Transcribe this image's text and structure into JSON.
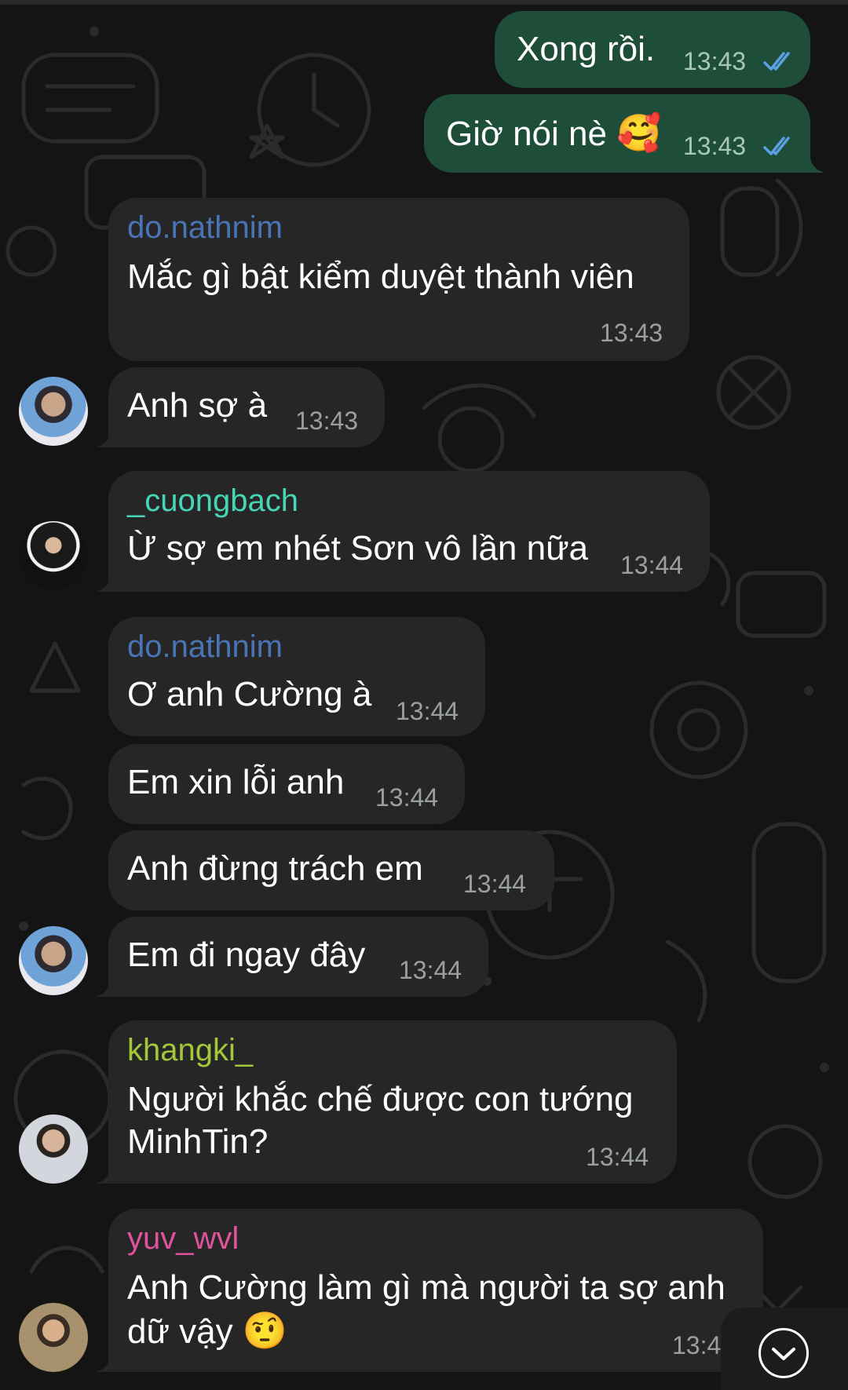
{
  "colors": {
    "background": "#141414",
    "incoming_bubble": "#262626",
    "outgoing_bubble": "#1e4d3a",
    "read_check": "#5aa0e0",
    "sender_do_nathnim": "#4a74b8",
    "sender_cuongbach": "#46d6b6",
    "sender_khangki": "#a4c63a",
    "sender_yuv_wvl": "#e0529c"
  },
  "messages": [
    {
      "direction": "out",
      "text": "Xong rồi.",
      "time": "13:43",
      "status": "read"
    },
    {
      "direction": "out",
      "text": "Giờ nói nè",
      "emoji": "🥰",
      "time": "13:43",
      "status": "read"
    },
    {
      "direction": "in",
      "sender": "do.nathnim",
      "text": "Mắc gì bật kiểm duyệt thành viên",
      "time": "13:43"
    },
    {
      "direction": "in",
      "text": "Anh sợ à",
      "time": "13:43"
    },
    {
      "direction": "in",
      "sender": "_cuongbach",
      "text": "Ừ sợ em nhét Sơn vô lần nữa",
      "time": "13:44"
    },
    {
      "direction": "in",
      "sender": "do.nathnim",
      "text": "Ơ anh Cường à",
      "time": "13:44"
    },
    {
      "direction": "in",
      "text": "Em xin lỗi anh",
      "time": "13:44"
    },
    {
      "direction": "in",
      "text": "Anh đừng trách em",
      "time": "13:44"
    },
    {
      "direction": "in",
      "text": "Em đi ngay đây",
      "time": "13:44"
    },
    {
      "direction": "in",
      "sender": "khangki_",
      "text_line1": "Người khắc chế được con tướng",
      "text_line2": "MinhTin?",
      "time": "13:44"
    },
    {
      "direction": "in",
      "sender": "yuv_wvl",
      "text_line1": "Anh Cường làm gì mà người ta sợ anh",
      "text_line2": "dữ vậy",
      "emoji": "🤨",
      "time": "13:4"
    }
  ],
  "scroll_down_icon": "chevron-down-icon"
}
